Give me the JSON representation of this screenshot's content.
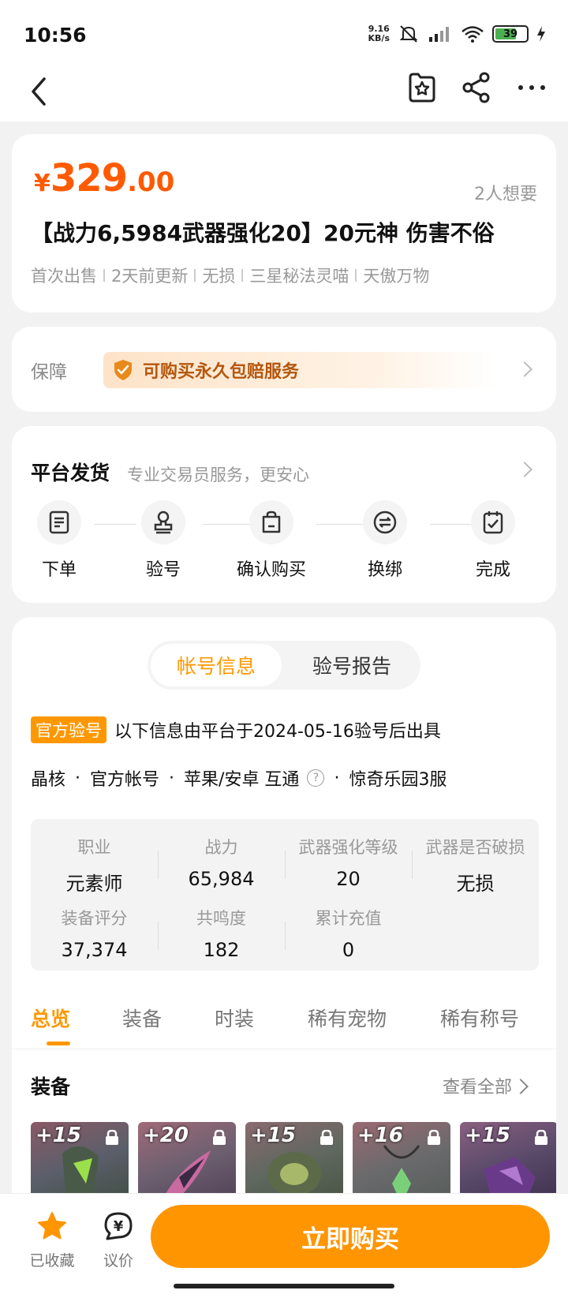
{
  "status": {
    "time": "10:56",
    "speed_value": "9.16",
    "speed_unit": "KB/s",
    "battery": "39"
  },
  "price": {
    "currency": "¥",
    "integer": "329",
    "decimal": ".00",
    "want": "2人想要"
  },
  "title": "【战力6,5984武器强化20】20元神 伤害不俗",
  "tags": [
    "首次出售",
    "2天前更新",
    "无损",
    "三星秘法灵喵",
    "天傲万物"
  ],
  "guarantee": {
    "label": "保障",
    "text": "可购买永久包赔服务"
  },
  "process": {
    "title": "平台发货",
    "subtitle": "专业交易员服务，更安心",
    "steps": [
      {
        "label": "下单",
        "icon": "order-icon"
      },
      {
        "label": "验号",
        "icon": "stamp-icon"
      },
      {
        "label": "确认购买",
        "icon": "bag-icon"
      },
      {
        "label": "换绑",
        "icon": "exchange-icon"
      },
      {
        "label": "完成",
        "icon": "check-icon"
      }
    ]
  },
  "info": {
    "segments": [
      "帐号信息",
      "验号报告"
    ],
    "verify_badge": "官方验号",
    "verify_text": "以下信息由平台于2024-05-16验号后出具",
    "attrs": [
      "晶核",
      "官方帐号",
      "苹果/安卓 互通",
      "惊奇乐园3服"
    ],
    "dot": "·",
    "stats": [
      {
        "k": "职业",
        "v": "元素师"
      },
      {
        "k": "战力",
        "v": "65,984"
      },
      {
        "k": "武器强化等级",
        "v": "20"
      },
      {
        "k": "武器是否破损",
        "v": "无损"
      },
      {
        "k": "装备评分",
        "v": "37,374"
      },
      {
        "k": "共鸣度",
        "v": "182"
      },
      {
        "k": "累计充值",
        "v": "0"
      }
    ],
    "tabs": [
      "总览",
      "装备",
      "时装",
      "稀有宠物",
      "稀有称号"
    ],
    "equip_title": "装备",
    "equip_more": "查看全部",
    "equips": [
      "+15",
      "+20",
      "+15",
      "+16",
      "+15"
    ]
  },
  "bottom": {
    "fav": "已收藏",
    "bargain": "议价",
    "bargain_symbol": "¥",
    "buy": "立即购买"
  },
  "colors": {
    "accent": "#ff9800",
    "price": "#ff5a00"
  }
}
